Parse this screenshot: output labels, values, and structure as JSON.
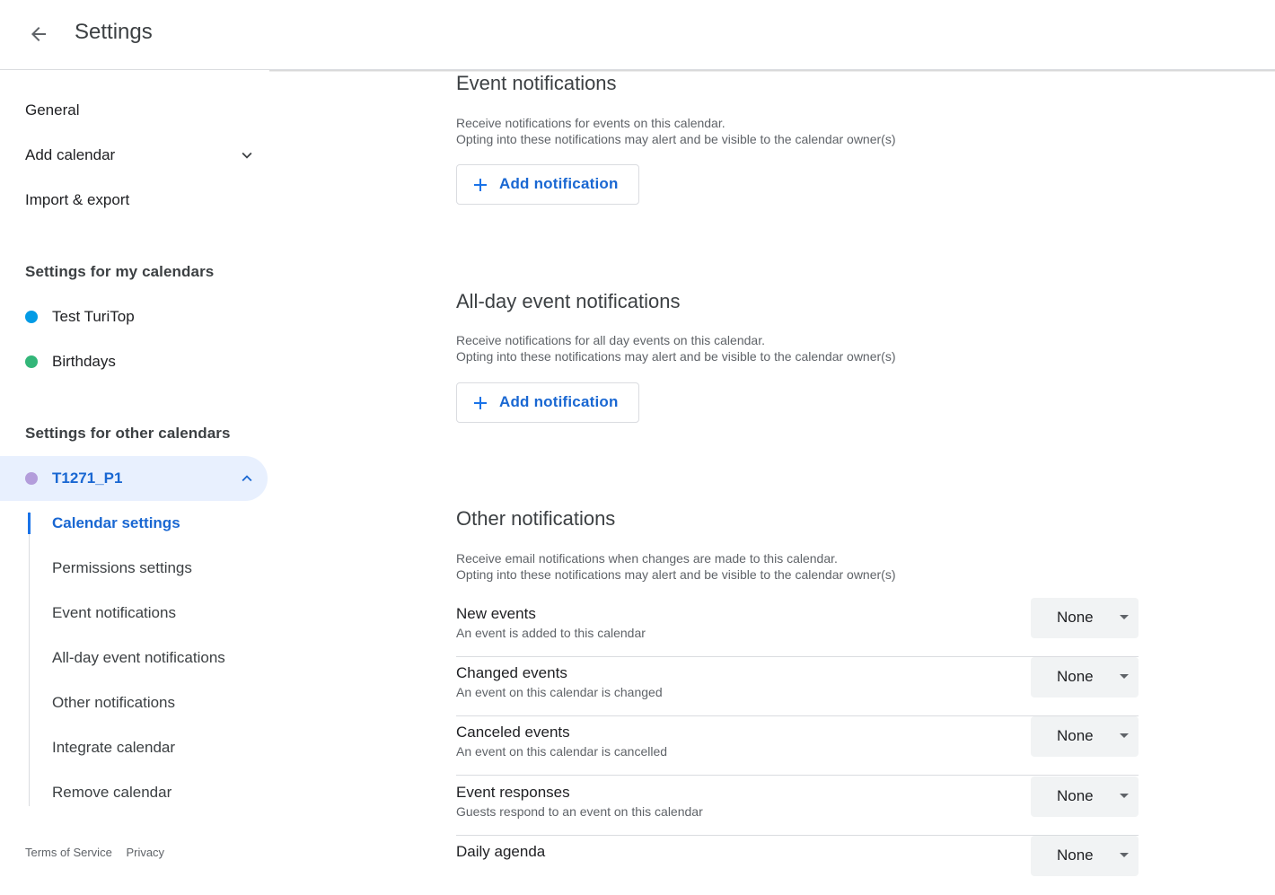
{
  "header": {
    "title": "Settings"
  },
  "sidebar": {
    "top_items": [
      {
        "label": "General"
      },
      {
        "label": "Add calendar"
      },
      {
        "label": "Import & export"
      }
    ],
    "my_calendars_title": "Settings for my calendars",
    "my_calendars": [
      {
        "label": "Test TuriTop",
        "color": "#039be5"
      },
      {
        "label": "Birthdays",
        "color": "#33b679"
      }
    ],
    "other_calendars_title": "Settings for other calendars",
    "other_calendars": [
      {
        "label": "T1271_P1",
        "color": "#b39ddb"
      }
    ],
    "sub_items": [
      {
        "label": "Calendar settings"
      },
      {
        "label": "Permissions settings"
      },
      {
        "label": "Event notifications"
      },
      {
        "label": "All-day event notifications"
      },
      {
        "label": "Other notifications"
      },
      {
        "label": "Integrate calendar"
      },
      {
        "label": "Remove calendar"
      }
    ],
    "footer": {
      "terms": "Terms of Service",
      "privacy": "Privacy"
    }
  },
  "main": {
    "event_notifications": {
      "heading": "Event notifications",
      "desc_line1": "Receive notifications for events on this calendar.",
      "desc_line2": "Opting into these notifications may alert and be visible to the calendar owner(s)",
      "button": "Add notification"
    },
    "allday_notifications": {
      "heading": "All-day event notifications",
      "desc_line1": "Receive notifications for all day events on this calendar.",
      "desc_line2": "Opting into these notifications may alert and be visible to the calendar owner(s)",
      "button": "Add notification"
    },
    "other_notifications": {
      "heading": "Other notifications",
      "desc_line1": "Receive email notifications when changes are made to this calendar.",
      "desc_line2": "Opting into these notifications may alert and be visible to the calendar owner(s)",
      "rows": [
        {
          "title": "New events",
          "desc": "An event is added to this calendar",
          "value": "None"
        },
        {
          "title": "Changed events",
          "desc": "An event on this calendar is changed",
          "value": "None"
        },
        {
          "title": "Canceled events",
          "desc": "An event on this calendar is cancelled",
          "value": "None"
        },
        {
          "title": "Event responses",
          "desc": "Guests respond to an event on this calendar",
          "value": "None"
        },
        {
          "title": "Daily agenda",
          "desc": "",
          "value": "None"
        }
      ]
    }
  },
  "colors": {
    "accent": "#1967d2",
    "active_bg": "#e8f0fe"
  }
}
